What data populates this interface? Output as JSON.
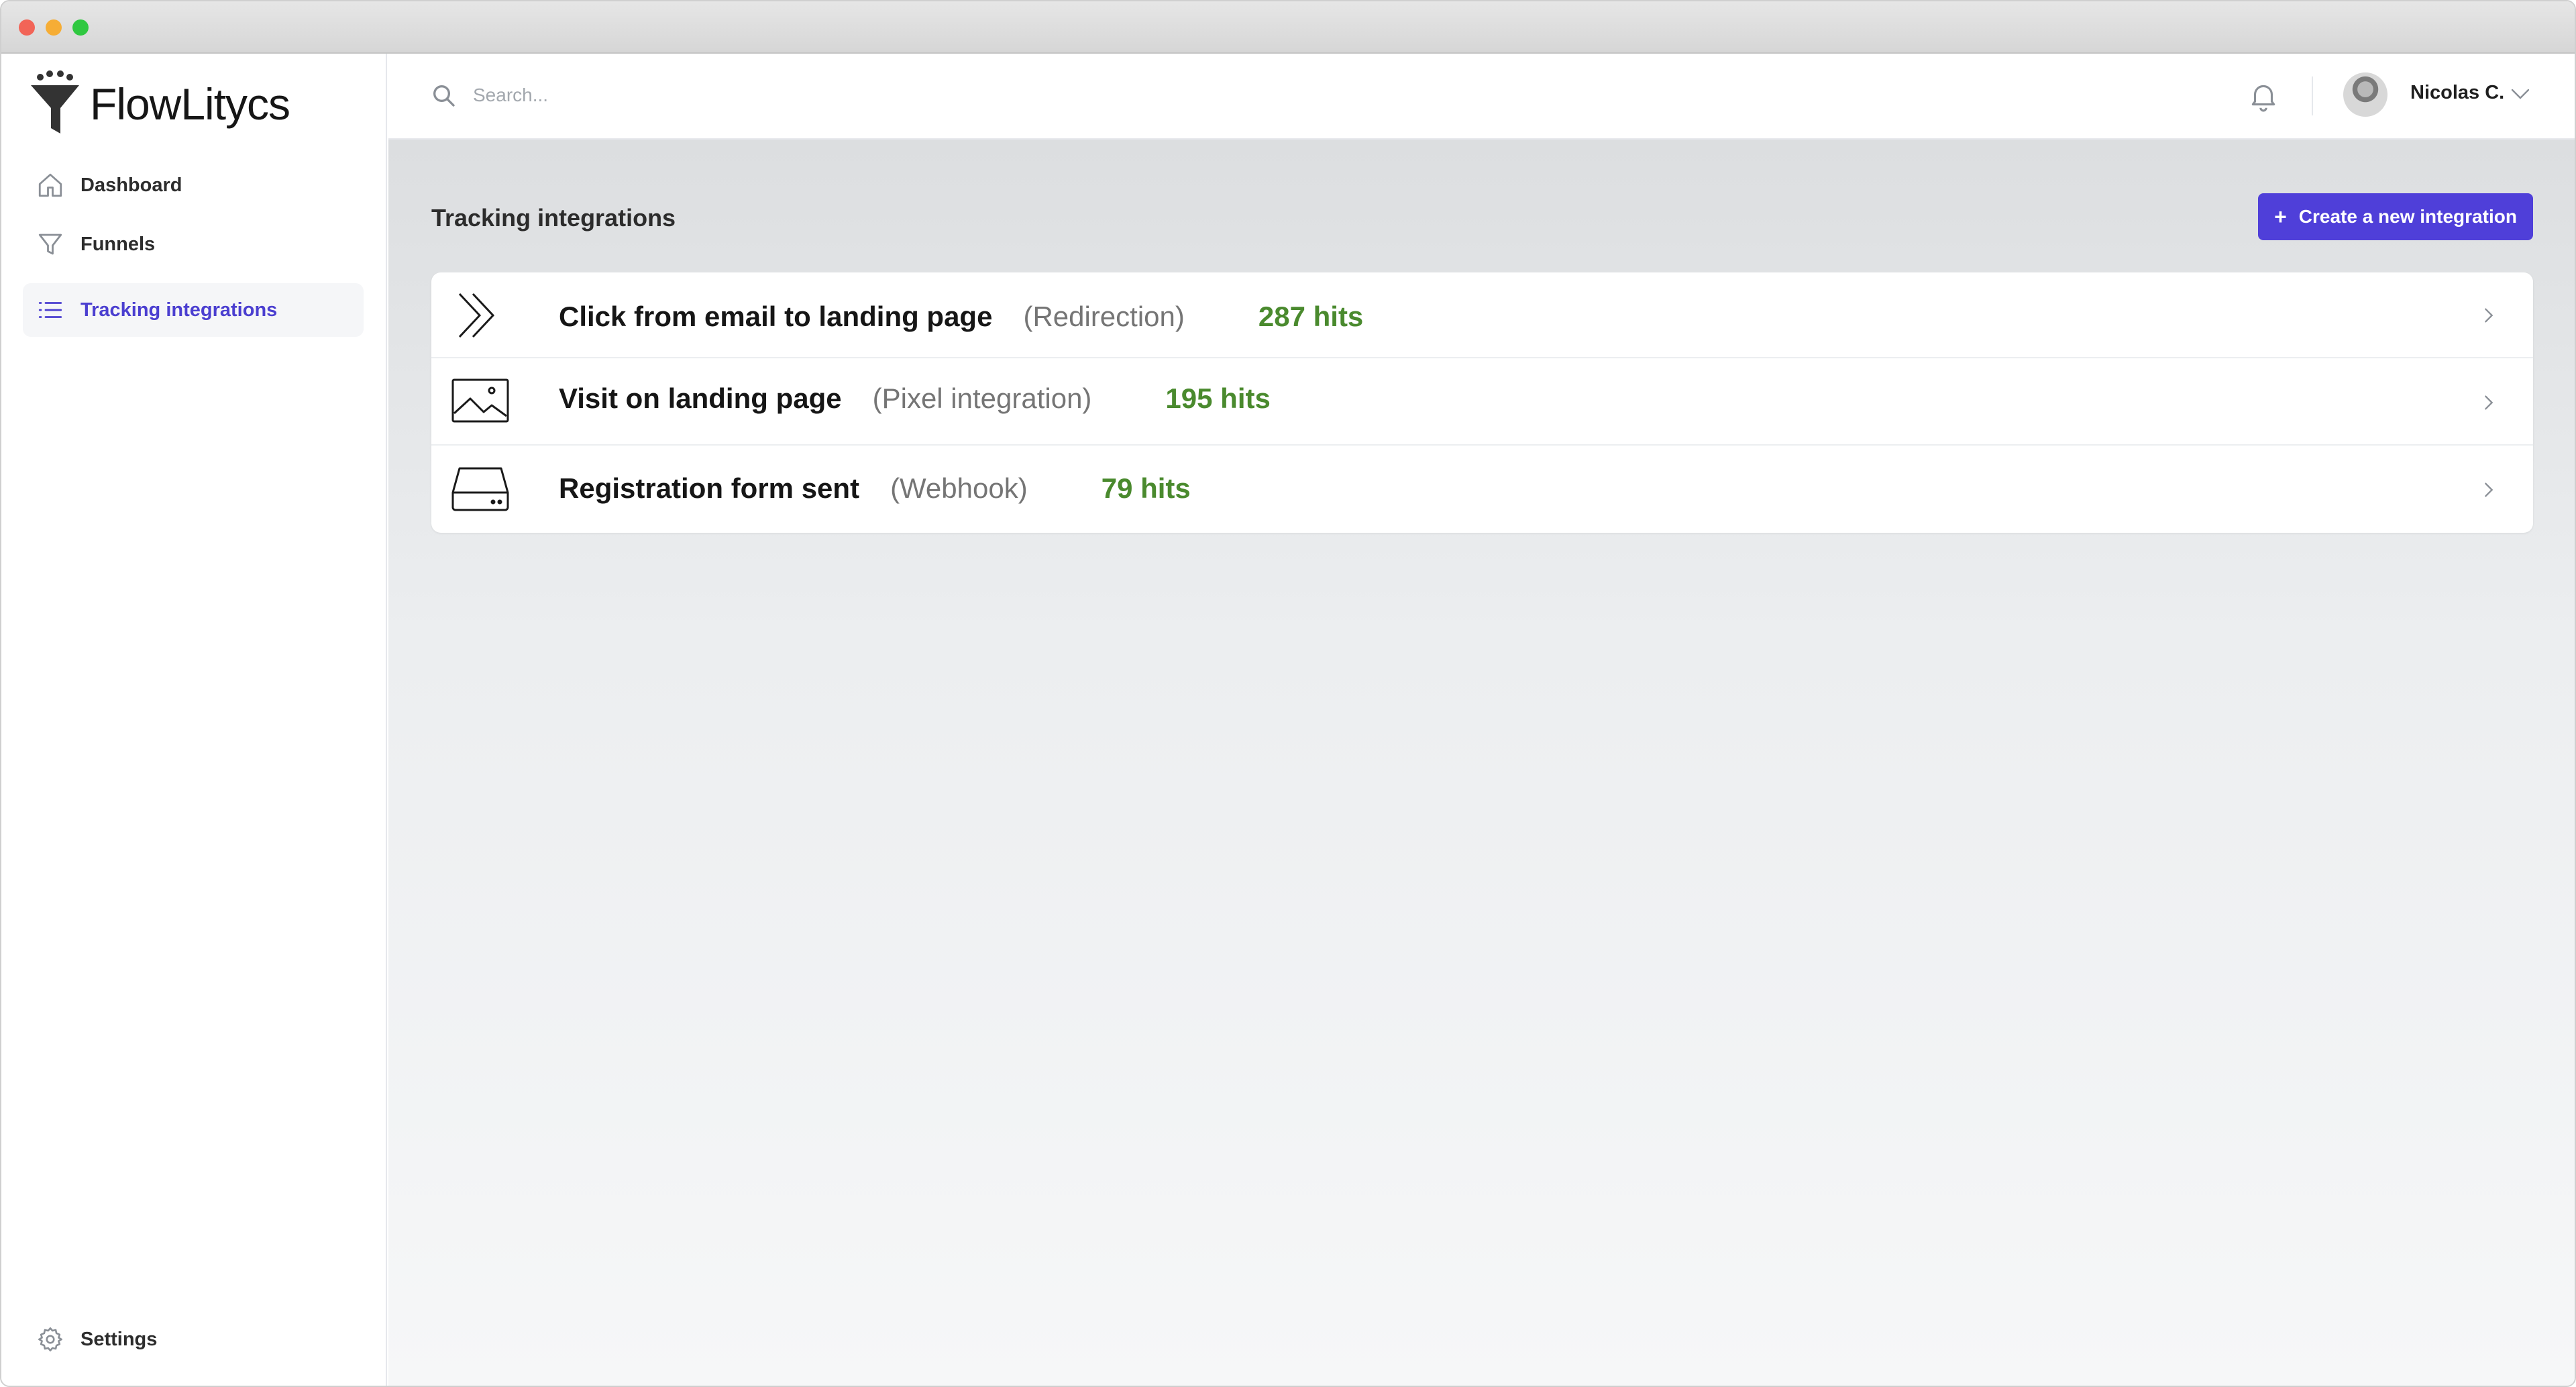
{
  "app": {
    "name": "FlowLitycs"
  },
  "sidebar": {
    "items": [
      {
        "label": "Dashboard",
        "icon": "home-icon"
      },
      {
        "label": "Funnels",
        "icon": "funnel-icon"
      },
      {
        "label": "Tracking integrations",
        "icon": "list-icon",
        "active": true
      }
    ],
    "settings": {
      "label": "Settings",
      "icon": "gear-icon"
    }
  },
  "header": {
    "search_placeholder": "Search...",
    "user_name": "Nicolas C."
  },
  "main": {
    "title": "Tracking integrations",
    "create_button": {
      "plus": "+",
      "label": "Create a new integration"
    },
    "integrations": [
      {
        "name": "Click from email to landing page",
        "type": "(Redirection)",
        "hits": "287 hits",
        "icon": "redirection-icon"
      },
      {
        "name": "Visit on landing page",
        "type": "(Pixel integration)",
        "hits": "195 hits",
        "icon": "image-icon"
      },
      {
        "name": "Registration form sent",
        "type": "(Webhook)",
        "hits": "79 hits",
        "icon": "drive-icon"
      }
    ]
  },
  "colors": {
    "accent": "#4f3fd9",
    "active_nav": "#4b3fd0",
    "hits_green": "#4a8a2e"
  }
}
